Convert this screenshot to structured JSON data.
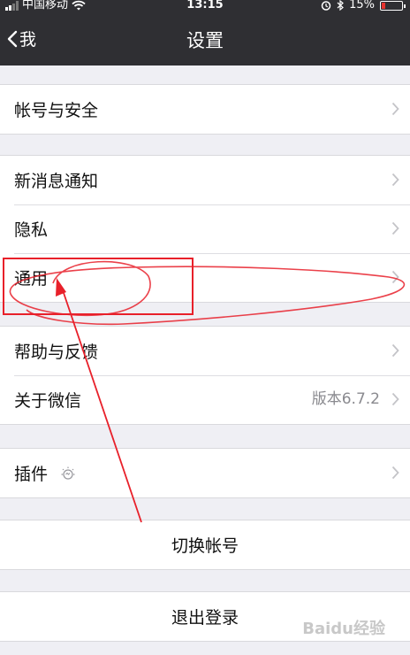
{
  "status_bar": {
    "carrier": "中国移动",
    "time": "13:15",
    "battery": "15%",
    "battery_level": 0.15,
    "icons": [
      "signal-icon",
      "wifi-icon",
      "alarm-icon",
      "bluetooth-icon",
      "battery-icon"
    ]
  },
  "nav": {
    "back_label": "我",
    "title": "设置"
  },
  "groups": {
    "account": {
      "items": [
        {
          "label": "帐号与安全"
        }
      ]
    },
    "general": {
      "items": [
        {
          "label": "新消息通知"
        },
        {
          "label": "隐私"
        },
        {
          "label": "通用"
        }
      ]
    },
    "help": {
      "items": [
        {
          "label": "帮助与反馈"
        },
        {
          "label": "关于微信",
          "value": "版本6.7.2"
        }
      ]
    },
    "plugins": {
      "items": [
        {
          "label": "插件"
        }
      ]
    }
  },
  "actions": {
    "switch_account": "切换帐号",
    "logout": "退出登录"
  },
  "colors": {
    "topbar": "#2f2f33",
    "background": "#efeff4",
    "annotation": "#e8202a"
  }
}
